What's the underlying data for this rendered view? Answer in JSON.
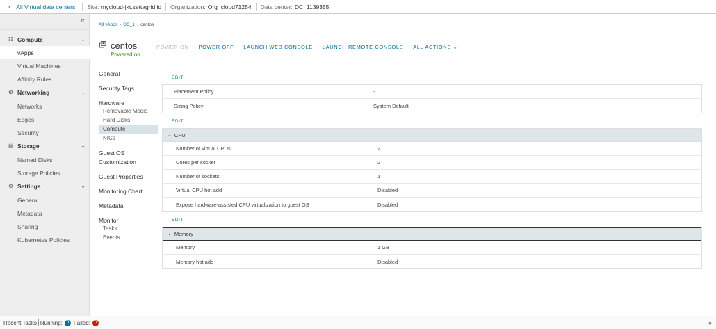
{
  "topbar": {
    "back_label": "All Virtual data centers",
    "site_label": "Site:",
    "site_value": "mycloud-jkt.zettagrid.id",
    "org_label": "Organization:",
    "org_value": "Org_cloud71254",
    "dc_label": "Data center:",
    "dc_value": "DC_1139355"
  },
  "sidebar": {
    "compute": {
      "label": "Compute",
      "items": [
        "vApps",
        "Virtual Machines",
        "Affinity Rules"
      ]
    },
    "networking": {
      "label": "Networking",
      "items": [
        "Networks",
        "Edges",
        "Security"
      ]
    },
    "storage": {
      "label": "Storage",
      "items": [
        "Named Disks",
        "Storage Policies"
      ]
    },
    "settings": {
      "label": "Settings",
      "items": [
        "General",
        "Metadata",
        "Sharing",
        "Kubernetes Policies"
      ]
    }
  },
  "breadcrumb": {
    "root": "All vApps",
    "dc": "DC_1",
    "current": "centos"
  },
  "vapp": {
    "name": "centos",
    "status": "Powered on",
    "status_color": "#2f8400"
  },
  "actions": [
    "POWER ON",
    "POWER OFF",
    "LAUNCH WEB CONSOLE",
    "LAUNCH REMOTE CONSOLE",
    "ALL ACTIONS"
  ],
  "subnav": {
    "general": "General",
    "security_tags": "Security Tags",
    "hardware": "Hardware",
    "hardware_items": [
      "Removable Media",
      "Hard Disks",
      "Compute",
      "NICs"
    ],
    "guest_os_1": "Guest OS",
    "guest_os_2": "Customization",
    "guest_properties": "Guest Properties",
    "monitoring_chart": "Monitoring Chart",
    "metadata": "Metadata",
    "monitor": "Monitor",
    "monitor_items": [
      "Tasks",
      "Events"
    ]
  },
  "edit_label": "EDIT",
  "policy_panel": {
    "rows": [
      {
        "label": "Placement Policy",
        "value": "-"
      },
      {
        "label": "Sizing Policy",
        "value": "System Default"
      }
    ]
  },
  "cpu_panel": {
    "title": "CPU",
    "rows": [
      {
        "label": "Number of virtual CPUs",
        "value": "2"
      },
      {
        "label": "Cores per socket",
        "value": "2"
      },
      {
        "label": "Number of sockets",
        "value": "1"
      },
      {
        "label": "Virtual CPU hot add",
        "value": "Disabled"
      },
      {
        "label": "Expose hardware-assisted CPU virtualization to guest OS",
        "value": "Disabled"
      }
    ]
  },
  "memory_panel": {
    "title": "Memory",
    "rows": [
      {
        "label": "Memory",
        "value": "1 GB"
      },
      {
        "label": "Memory hot add",
        "value": "Disabled"
      }
    ]
  },
  "footer": {
    "recent_tasks": "Recent Tasks",
    "running_label": "Running:",
    "running_count": "0",
    "failed_label": "Failed:",
    "failed_count": "0"
  }
}
